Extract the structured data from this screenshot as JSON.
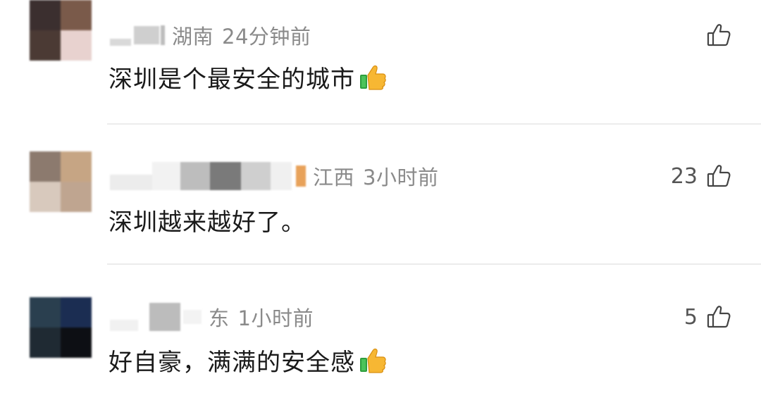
{
  "comments": [
    {
      "region": "湖南",
      "time": "24分钟前",
      "text": "深圳是个最安全的城市",
      "emoji": "thumbs-up-emoji",
      "likes": ""
    },
    {
      "region": "江西",
      "time": "3小时前",
      "text": "深圳越来越好了。",
      "emoji": "",
      "likes": "23"
    },
    {
      "region": "东",
      "time": "1小时前",
      "text": "好自豪，满满的安全感",
      "emoji": "thumbs-up-emoji",
      "likes": "5"
    }
  ],
  "icons": {
    "like": "thumbs-up-outline-icon"
  },
  "colors": {
    "meta": "#8a8a8a",
    "text": "#1a1a1a",
    "divider": "#ececec"
  }
}
